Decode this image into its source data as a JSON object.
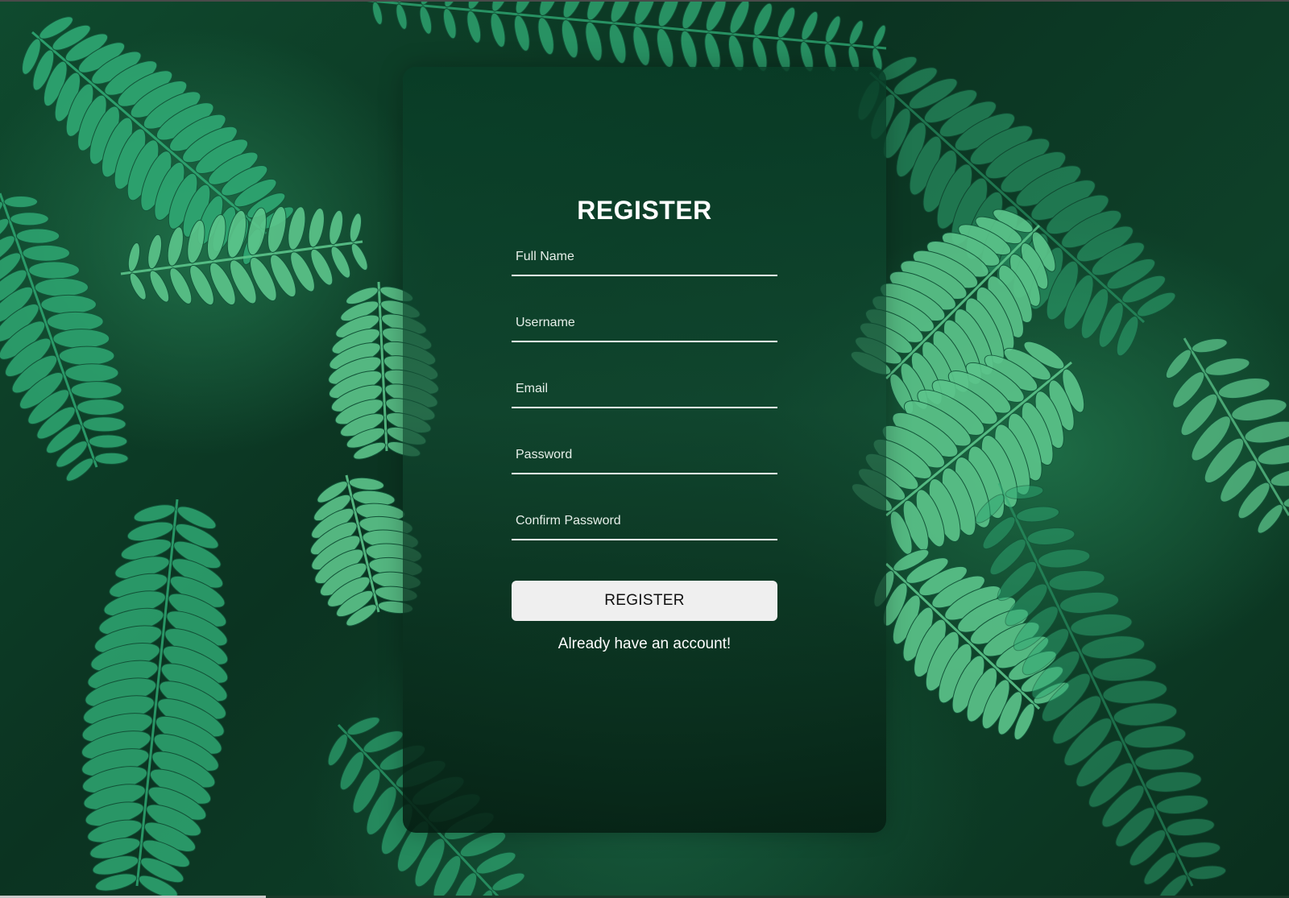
{
  "form": {
    "title": "REGISTER",
    "fields": [
      {
        "placeholder": "Full Name",
        "type": "text"
      },
      {
        "placeholder": "Username",
        "type": "text"
      },
      {
        "placeholder": "Email",
        "type": "email"
      },
      {
        "placeholder": "Password",
        "type": "password"
      },
      {
        "placeholder": "Confirm Password",
        "type": "password"
      }
    ],
    "submit_label": "REGISTER",
    "login_link": "Already have an account!"
  },
  "colors": {
    "background": "#0e3a24",
    "leaf_primary": "#2fa873",
    "leaf_light": "#5cc58b",
    "card_overlay": "#0b3c26",
    "text": "#ffffff",
    "button_bg": "#efefef",
    "button_text": "#111111"
  }
}
